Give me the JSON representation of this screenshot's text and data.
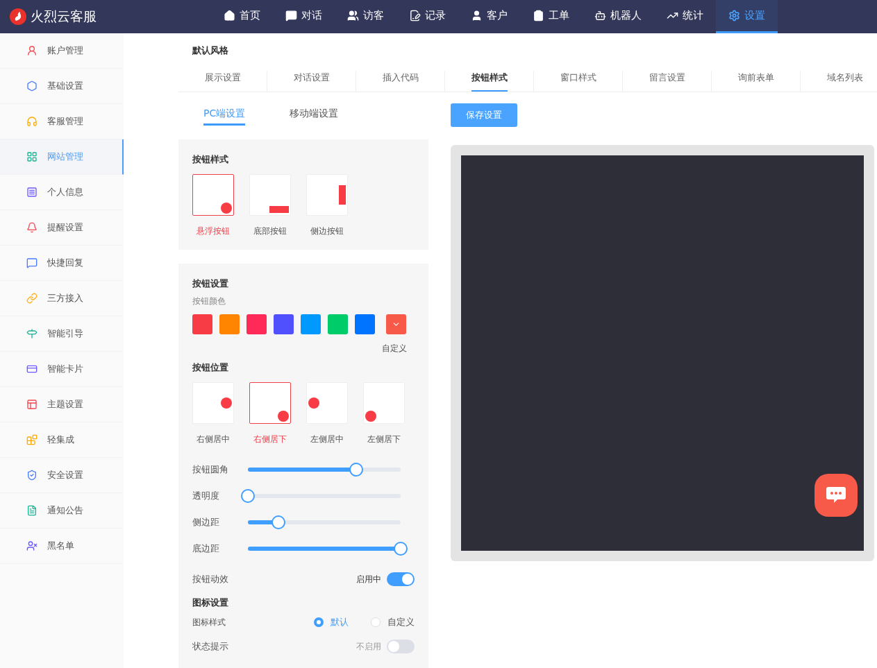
{
  "brand": {
    "name": "火烈云客服"
  },
  "nav": [
    {
      "label": "首页",
      "selected": false
    },
    {
      "label": "对话",
      "selected": false
    },
    {
      "label": "访客",
      "selected": false
    },
    {
      "label": "记录",
      "selected": false
    },
    {
      "label": "客户",
      "selected": false
    },
    {
      "label": "工单",
      "selected": false
    },
    {
      "label": "机器人",
      "selected": false
    },
    {
      "label": "统计",
      "selected": false
    },
    {
      "label": "设置",
      "selected": true
    }
  ],
  "sidebar": {
    "items": [
      {
        "label": "账户管理",
        "selected": false
      },
      {
        "label": "基础设置",
        "selected": false
      },
      {
        "label": "客服管理",
        "selected": false
      },
      {
        "label": "网站管理",
        "selected": true
      },
      {
        "label": "个人信息",
        "selected": false
      },
      {
        "label": "提醒设置",
        "selected": false
      },
      {
        "label": "快捷回复",
        "selected": false
      },
      {
        "label": "三方接入",
        "selected": false
      },
      {
        "label": "智能引导",
        "selected": false
      },
      {
        "label": "智能卡片",
        "selected": false
      },
      {
        "label": "主题设置",
        "selected": false
      },
      {
        "label": "轻集成",
        "selected": false
      },
      {
        "label": "安全设置",
        "selected": false
      },
      {
        "label": "通知公告",
        "selected": false
      },
      {
        "label": "黑名单",
        "selected": false
      }
    ]
  },
  "section_title": "默认风格",
  "tabs": [
    {
      "label": "展示设置",
      "selected": false
    },
    {
      "label": "对话设置",
      "selected": false
    },
    {
      "label": "插入代码",
      "selected": false
    },
    {
      "label": "按钮样式",
      "selected": true
    },
    {
      "label": "窗口样式",
      "selected": false
    },
    {
      "label": "留言设置",
      "selected": false
    },
    {
      "label": "询前表单",
      "selected": false
    },
    {
      "label": "域名列表",
      "selected": false
    }
  ],
  "subtabs": [
    {
      "label": "PC端设置",
      "selected": true
    },
    {
      "label": "移动端设置",
      "selected": false
    }
  ],
  "save_button": "保存设置",
  "button_style": {
    "title": "按钮样式",
    "options": [
      {
        "label": "悬浮按钮",
        "kind": "float",
        "selected": true
      },
      {
        "label": "底部按钮",
        "kind": "bottom",
        "selected": false
      },
      {
        "label": "侧边按钮",
        "kind": "side",
        "selected": false
      }
    ]
  },
  "button_settings": {
    "title": "按钮设置",
    "color_label": "按钮颜色",
    "colors": [
      {
        "kind": "preset",
        "color": "#f73c45"
      },
      {
        "kind": "preset",
        "color": "#ff8500"
      },
      {
        "kind": "preset",
        "color": "#ff2a58"
      },
      {
        "kind": "preset",
        "color": "#5050ff"
      },
      {
        "kind": "preset",
        "color": "#0099ff"
      },
      {
        "kind": "preset",
        "color": "#00cc6a"
      },
      {
        "kind": "preset",
        "color": "#0073ff"
      },
      {
        "kind": "custom",
        "color": "#f85a4a"
      }
    ],
    "custom_label": "自定义",
    "position_title": "按钮位置",
    "positions": [
      {
        "label": "右侧居中",
        "kind": "right-middle",
        "selected": false
      },
      {
        "label": "右侧居下",
        "kind": "right-bottom",
        "selected": true
      },
      {
        "label": "左侧居中",
        "kind": "left-middle",
        "selected": false
      },
      {
        "label": "左侧居下",
        "kind": "left-bottom",
        "selected": false
      }
    ],
    "sliders": [
      {
        "label": "按钮圆角",
        "level": 0.71
      },
      {
        "label": "透明度",
        "level": 0
      },
      {
        "label": "侧边距",
        "level": 0.2
      },
      {
        "label": "底边距",
        "level": 1
      }
    ],
    "animation": {
      "label": "按钮动效",
      "status": "启用中",
      "on": true
    }
  },
  "icon_settings": {
    "title": "图标设置",
    "style_label": "图标样式",
    "options": [
      {
        "label": "默认",
        "selected": true
      },
      {
        "label": "自定义",
        "selected": false
      }
    ],
    "status_hint": {
      "label": "状态提示",
      "status": "不启用",
      "on": false
    }
  }
}
